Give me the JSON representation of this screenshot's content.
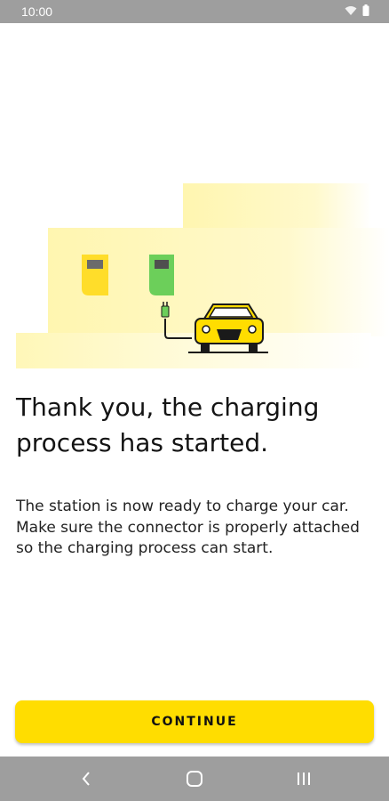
{
  "status_bar": {
    "time": "10:00",
    "icons": [
      "wifi-icon",
      "battery-icon"
    ]
  },
  "illustration": {
    "description_icons": [
      "charging-station-yellow",
      "charging-station-green",
      "car-icon",
      "plug-icon"
    ],
    "colors": {
      "background_light": "#fff7b8",
      "station_yellow": "#ffdd2a",
      "station_green": "#6ccf5a",
      "car_yellow": "#ffdd00",
      "outline": "#1a1a1a"
    }
  },
  "content": {
    "title": "Thank you, the charging process has started.",
    "body": "The station is now ready to charge your car. Make sure the connector is properly attached so the charging process can start."
  },
  "actions": {
    "continue_label": "CONTINUE"
  },
  "nav_bar": {
    "buttons": [
      "back-icon",
      "home-icon",
      "recents-icon"
    ]
  },
  "theme": {
    "accent": "#ffdd00",
    "system_bar": "#9e9e9e"
  }
}
